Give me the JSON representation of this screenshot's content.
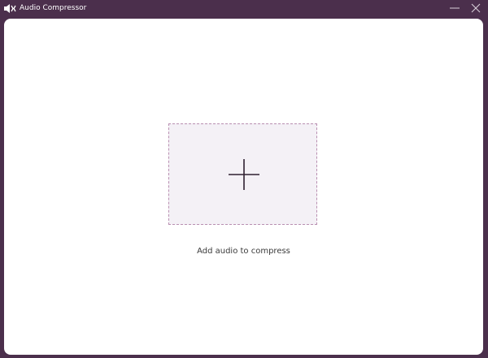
{
  "window": {
    "title": "Audio Compressor",
    "icons": {
      "app": "speaker-compress-icon",
      "minimize": "minimize-icon",
      "close": "close-icon",
      "add": "plus-icon"
    }
  },
  "main": {
    "hint": "Add audio to compress"
  },
  "colors": {
    "frame": "#4b2f4c",
    "panel": "#ffffff",
    "dropzone_bg": "#f4f1f6",
    "dropzone_border": "#b98fb1",
    "icon": "#2e2130"
  }
}
